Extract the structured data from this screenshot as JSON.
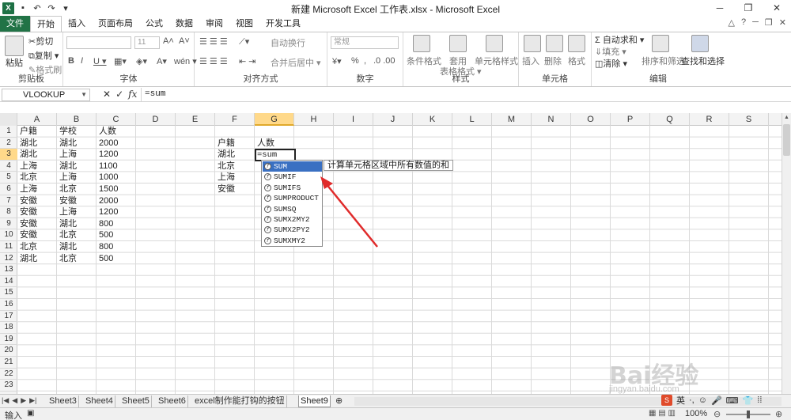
{
  "title_bar": {
    "title": "新建 Microsoft Excel 工作表.xlsx - Microsoft Excel",
    "excel_logo": "X",
    "window_controls": [
      "─",
      "❐",
      "✕"
    ]
  },
  "tabs": [
    "文件",
    "开始",
    "插入",
    "页面布局",
    "公式",
    "数据",
    "审阅",
    "视图",
    "开发工具"
  ],
  "ribbon": {
    "clipboard": {
      "label": "剪贴板",
      "paste": "粘贴",
      "cut": "剪切",
      "copy": "复制 ▾",
      "format_painter": "格式刷"
    },
    "font": {
      "label": "字体",
      "font_size": "11",
      "bold": "B",
      "italic": "I",
      "underline": "U ▾",
      "grow": "A˄",
      "shrink": "A˅",
      "wen": "wén ▾"
    },
    "alignment": {
      "label": "对齐方式",
      "wrap": "自动换行",
      "merge": "合并后居中 ▾"
    },
    "number": {
      "label": "数字",
      "format": "常规",
      "percent": "%",
      "comma": ","
    },
    "styles": {
      "label": "样式",
      "conditional": "条件格式",
      "table": "套用",
      "table2": "表格格式 ▾",
      "cell_styles": "单元格样式"
    },
    "cells": {
      "label": "单元格",
      "insert": "插入",
      "delete": "删除",
      "format": "格式"
    },
    "editing": {
      "label": "编辑",
      "autosum": "Σ 自动求和 ▾",
      "fill": "填充 ▾",
      "clear": "清除 ▾",
      "sort": "排序和筛选",
      "find": "查找和选择"
    }
  },
  "formula_bar": {
    "name_box": "VLOOKUP",
    "cancel": "✕",
    "enter": "✓",
    "fx": "fx",
    "content": "=sum"
  },
  "columns": [
    "A",
    "B",
    "C",
    "D",
    "E",
    "F",
    "G",
    "H",
    "I",
    "J",
    "K",
    "L",
    "M",
    "N",
    "O",
    "P",
    "Q",
    "R",
    "S"
  ],
  "rows": [
    "1",
    "2",
    "3",
    "4",
    "5",
    "6",
    "7",
    "8",
    "9",
    "10",
    "11",
    "12",
    "13",
    "14",
    "15",
    "16",
    "17",
    "18",
    "19",
    "20",
    "21",
    "22",
    "23"
  ],
  "table_a": {
    "headers": [
      "户籍",
      "学校",
      "人数"
    ],
    "rows": [
      [
        "湖北",
        "湖北",
        "2000"
      ],
      [
        "湖北",
        "上海",
        "1200"
      ],
      [
        "上海",
        "湖北",
        "1100"
      ],
      [
        "北京",
        "上海",
        "1000"
      ],
      [
        "上海",
        "北京",
        "1500"
      ],
      [
        "安徽",
        "安徽",
        "2000"
      ],
      [
        "安徽",
        "上海",
        "1200"
      ],
      [
        "安徽",
        "湖北",
        "800"
      ],
      [
        "安徽",
        "北京",
        "500"
      ],
      [
        "北京",
        "湖北",
        "800"
      ],
      [
        "湖北",
        "北京",
        "500"
      ]
    ]
  },
  "table_f": {
    "headers": [
      "户籍",
      "人数"
    ],
    "rows": [
      "湖北",
      "北京",
      "上海",
      "安徽"
    ]
  },
  "active_cell_text": "=sum",
  "autocomplete": {
    "items": [
      "SUM",
      "SUMIF",
      "SUMIFS",
      "SUMPRODUCT",
      "SUMSQ",
      "SUMX2MY2",
      "SUMX2PY2",
      "SUMXMY2"
    ],
    "selected_index": 0,
    "tooltip": "计算单元格区域中所有数值的和"
  },
  "sheet_tabs": [
    "Sheet3",
    "Sheet4",
    "Sheet5",
    "Sheet6",
    "excel制作能打钩的按钮",
    "Sheet9"
  ],
  "active_sheet": "Sheet9",
  "status": {
    "mode": "输入",
    "zoom": "100%"
  },
  "ime_bar": {
    "lang": "英"
  },
  "watermark": {
    "brand": "Bai经验",
    "url": "jingyan.baidu.com"
  },
  "colors": {
    "excel_green": "#217346",
    "selection_blue": "#3a70c2",
    "arrow_red": "#e02b2b",
    "header_highlight": "#ffd98a"
  }
}
